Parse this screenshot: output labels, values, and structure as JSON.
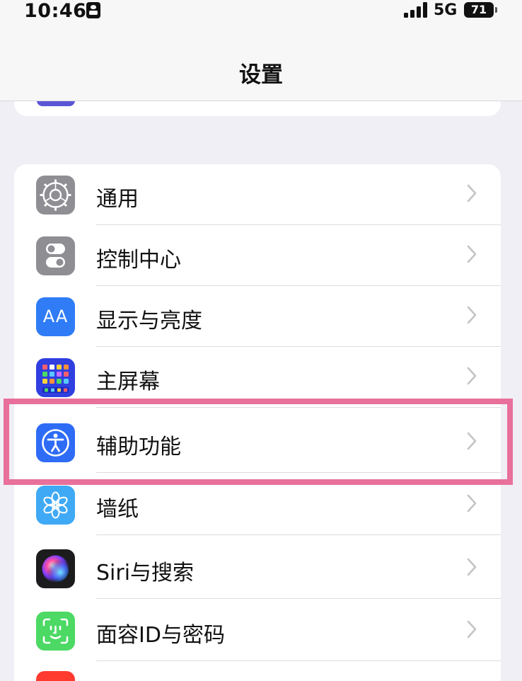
{
  "status_bar": {
    "time": "10:46",
    "network": "5G",
    "battery": "71"
  },
  "nav": {
    "title": "设置"
  },
  "rows": [
    {
      "label": "通用",
      "icon": "gear-icon",
      "color": "#8e8e93"
    },
    {
      "label": "控制中心",
      "icon": "toggle-switches-icon",
      "color": "#8e8e93"
    },
    {
      "label": "显示与亮度",
      "icon": "text-size-icon",
      "icon_text": "AA",
      "color": "#2f7cf6"
    },
    {
      "label": "主屏幕",
      "icon": "app-grid-icon",
      "color": "#2f3fe0"
    },
    {
      "label": "辅助功能",
      "icon": "accessibility-icon",
      "color": "#2f6cf6"
    },
    {
      "label": "墙纸",
      "icon": "flower-icon",
      "color": "#3fa9f5"
    },
    {
      "label": "Siri与搜索",
      "icon": "siri-icon",
      "color": "#1c1c1e"
    },
    {
      "label": "面容ID与密码",
      "icon": "face-id-icon",
      "color": "#4cd964"
    }
  ],
  "highlight_color": "#e8709a"
}
